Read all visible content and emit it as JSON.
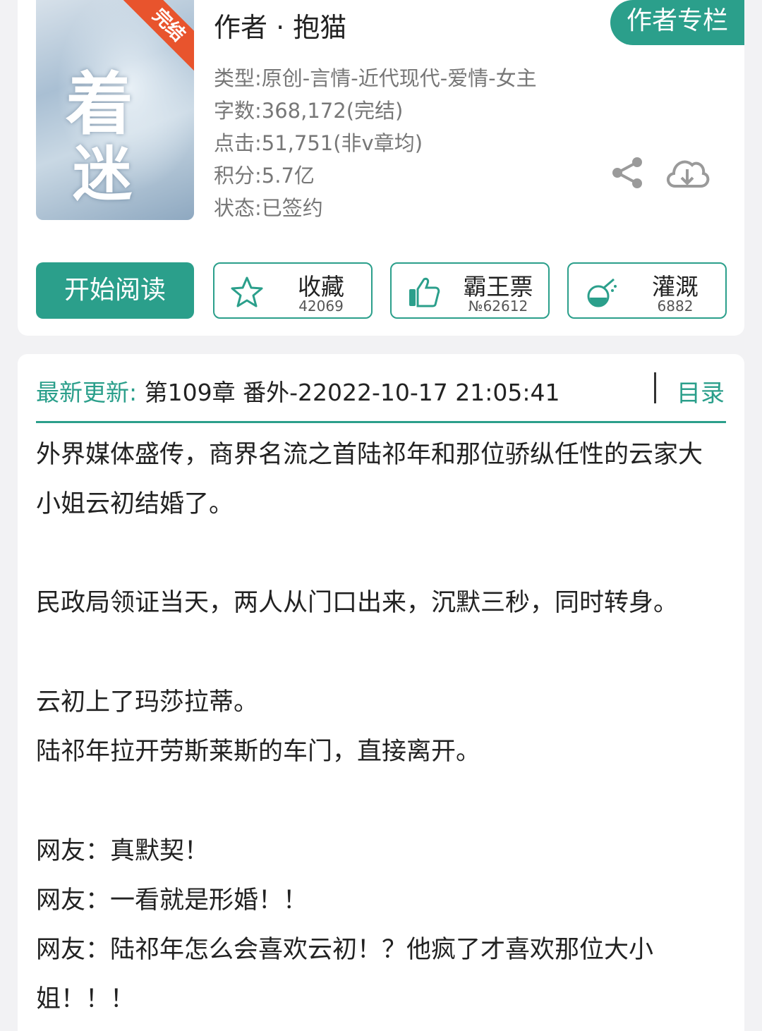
{
  "book": {
    "status_ribbon": "完结",
    "cover_title": "着迷",
    "author": "作者 · 抱猫",
    "type": "类型:原创-言情-近代现代-爱情-女主",
    "word_count": "字数:368,172(完结)",
    "clicks": "点击:51,751(非v章均)",
    "score": "积分:5.7亿",
    "status": "状态:已签约"
  },
  "header_actions": {
    "author_column": "作者专栏",
    "share_icon": "share-icon",
    "download_icon": "cloud-download-icon"
  },
  "actions": {
    "start_reading": "开始阅读",
    "favorite": {
      "label": "收藏",
      "count": "42069",
      "icon": "star-icon"
    },
    "vote": {
      "label": "霸王票",
      "count": "№62612",
      "icon": "thumbs-up-icon"
    },
    "nourish": {
      "label": "灌溉",
      "count": "6882",
      "icon": "watering-flask-icon"
    }
  },
  "update": {
    "label": "最新更新:",
    "text": "第109章 番外-22022-10-17 21:05:41",
    "toc": "目录"
  },
  "summary": {
    "p1": "外界媒体盛传，商界名流之首陆祁年和那位骄纵任性的云家大小姐云初结婚了。",
    "p2": "民政局领证当天，两人从门口出来，沉默三秒，同时转身。",
    "p3": "云初上了玛莎拉蒂。",
    "p4": "陆祁年拉开劳斯莱斯的车门，直接离开。",
    "p5": "网友：真默契！",
    "p6": "网友：一看就是形婚！！",
    "p7": "网友：陆祁年怎么会喜欢云初！？他疯了才喜欢那位大小姐！！！"
  },
  "colors": {
    "accent": "#2b9f8b",
    "ribbon": "#e8542d",
    "background": "#f2f2f4"
  }
}
